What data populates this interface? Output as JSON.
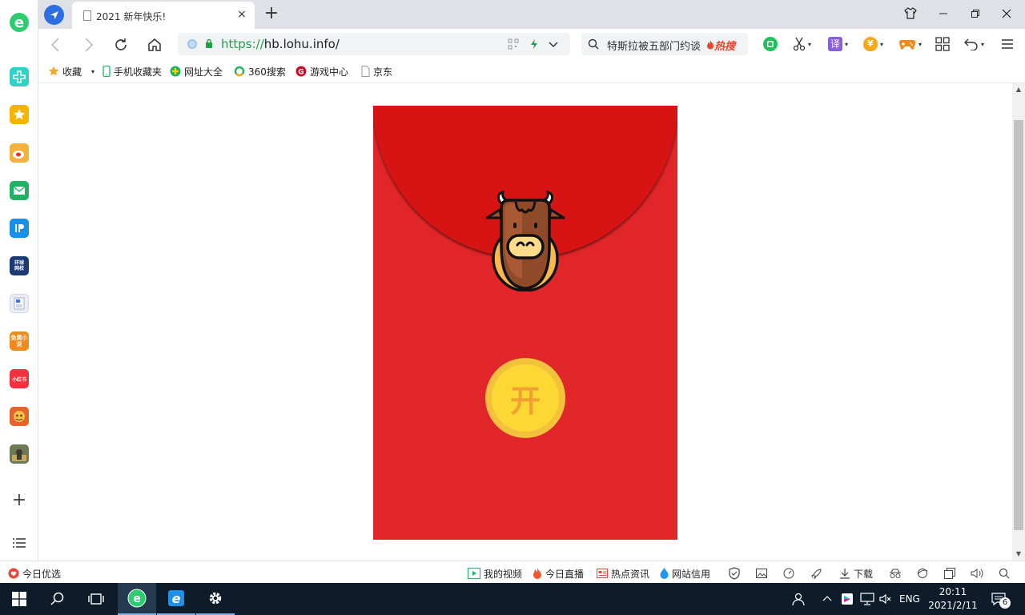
{
  "browser": {
    "tab": {
      "title": "2021 新年快乐!",
      "close_label": "×"
    },
    "new_tab_label": "+",
    "address": {
      "scheme": "https://",
      "host": "hb.lohu.info/"
    },
    "search": {
      "query": "特斯拉被五部门约谈",
      "hot_label": "热搜"
    },
    "extensions": [
      {
        "name": "wechat-icon"
      },
      {
        "name": "scissors-icon"
      },
      {
        "name": "translate-icon",
        "label": "译"
      },
      {
        "name": "coupon-icon",
        "label": "¥"
      },
      {
        "name": "game-icon"
      },
      {
        "name": "apps-grid-icon"
      },
      {
        "name": "undo-icon"
      },
      {
        "name": "menu-icon"
      }
    ]
  },
  "bookmarks": [
    {
      "label": "收藏",
      "icon": "star-icon"
    },
    {
      "label": "手机收藏夹",
      "icon": "phone-icon"
    },
    {
      "label": "网址大全",
      "icon": "site-nav-icon"
    },
    {
      "label": "360搜索",
      "icon": "search-360-icon"
    },
    {
      "label": "游戏中心",
      "icon": "game-center-icon"
    },
    {
      "label": "京东",
      "icon": "page-icon"
    }
  ],
  "sidebar_apps": [
    {
      "name": "plus-health-icon",
      "color": "#2fd3c4"
    },
    {
      "name": "favorites-star-icon",
      "color": "#f5b400"
    },
    {
      "name": "weibo-icon",
      "color": "#f3b23a"
    },
    {
      "name": "mail-icon",
      "color": "#1fb263"
    },
    {
      "name": "ip-app-icon",
      "color": "#1890e8"
    },
    {
      "name": "huanqiu-icon",
      "label": "环球\n网校",
      "color": "#1d3b73"
    },
    {
      "name": "document-icon",
      "color": "#e9eef6"
    },
    {
      "name": "novel-icon",
      "label": "免费小说",
      "color": "#f08a1c"
    },
    {
      "name": "xiaohongshu-icon",
      "label": "小红书",
      "color": "#f0323c"
    },
    {
      "name": "game-avatar-icon",
      "color": "#e8632b"
    },
    {
      "name": "pubg-icon",
      "color": "#6b7a52"
    }
  ],
  "page": {
    "open_button_label": "开",
    "colors": {
      "envelope": "#e1262a",
      "flap": "#d71414",
      "coin_outer": "#f4c13d",
      "coin_inner": "#fdd835",
      "coin_text": "#f0a130"
    }
  },
  "statusbar": {
    "left": "今日优选",
    "items": [
      "我的视频",
      "今日直播",
      "热点资讯",
      "网站信用"
    ],
    "download_label": "下载"
  },
  "taskbar": {
    "lang": "ENG",
    "time": "20:11",
    "date": "2021/2/11",
    "notification_count": "6"
  }
}
